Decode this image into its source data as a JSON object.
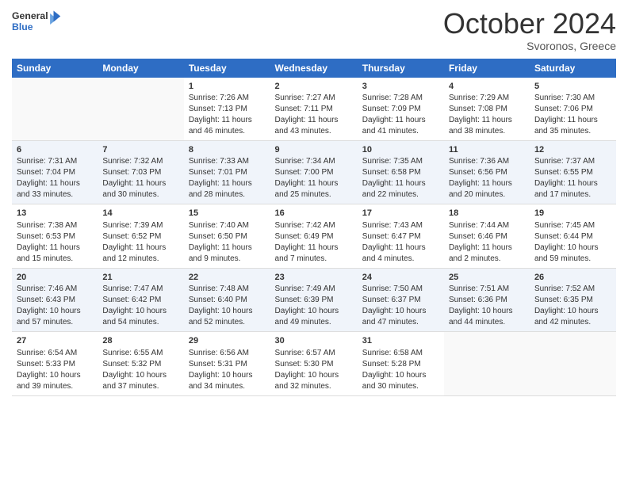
{
  "header": {
    "logo_line1": "General",
    "logo_line2": "Blue",
    "month": "October 2024",
    "location": "Svoronos, Greece"
  },
  "days_of_week": [
    "Sunday",
    "Monday",
    "Tuesday",
    "Wednesday",
    "Thursday",
    "Friday",
    "Saturday"
  ],
  "weeks": [
    [
      {
        "day": "",
        "info": ""
      },
      {
        "day": "",
        "info": ""
      },
      {
        "day": "1",
        "info": "Sunrise: 7:26 AM\nSunset: 7:13 PM\nDaylight: 11 hours and 46 minutes."
      },
      {
        "day": "2",
        "info": "Sunrise: 7:27 AM\nSunset: 7:11 PM\nDaylight: 11 hours and 43 minutes."
      },
      {
        "day": "3",
        "info": "Sunrise: 7:28 AM\nSunset: 7:09 PM\nDaylight: 11 hours and 41 minutes."
      },
      {
        "day": "4",
        "info": "Sunrise: 7:29 AM\nSunset: 7:08 PM\nDaylight: 11 hours and 38 minutes."
      },
      {
        "day": "5",
        "info": "Sunrise: 7:30 AM\nSunset: 7:06 PM\nDaylight: 11 hours and 35 minutes."
      }
    ],
    [
      {
        "day": "6",
        "info": "Sunrise: 7:31 AM\nSunset: 7:04 PM\nDaylight: 11 hours and 33 minutes."
      },
      {
        "day": "7",
        "info": "Sunrise: 7:32 AM\nSunset: 7:03 PM\nDaylight: 11 hours and 30 minutes."
      },
      {
        "day": "8",
        "info": "Sunrise: 7:33 AM\nSunset: 7:01 PM\nDaylight: 11 hours and 28 minutes."
      },
      {
        "day": "9",
        "info": "Sunrise: 7:34 AM\nSunset: 7:00 PM\nDaylight: 11 hours and 25 minutes."
      },
      {
        "day": "10",
        "info": "Sunrise: 7:35 AM\nSunset: 6:58 PM\nDaylight: 11 hours and 22 minutes."
      },
      {
        "day": "11",
        "info": "Sunrise: 7:36 AM\nSunset: 6:56 PM\nDaylight: 11 hours and 20 minutes."
      },
      {
        "day": "12",
        "info": "Sunrise: 7:37 AM\nSunset: 6:55 PM\nDaylight: 11 hours and 17 minutes."
      }
    ],
    [
      {
        "day": "13",
        "info": "Sunrise: 7:38 AM\nSunset: 6:53 PM\nDaylight: 11 hours and 15 minutes."
      },
      {
        "day": "14",
        "info": "Sunrise: 7:39 AM\nSunset: 6:52 PM\nDaylight: 11 hours and 12 minutes."
      },
      {
        "day": "15",
        "info": "Sunrise: 7:40 AM\nSunset: 6:50 PM\nDaylight: 11 hours and 9 minutes."
      },
      {
        "day": "16",
        "info": "Sunrise: 7:42 AM\nSunset: 6:49 PM\nDaylight: 11 hours and 7 minutes."
      },
      {
        "day": "17",
        "info": "Sunrise: 7:43 AM\nSunset: 6:47 PM\nDaylight: 11 hours and 4 minutes."
      },
      {
        "day": "18",
        "info": "Sunrise: 7:44 AM\nSunset: 6:46 PM\nDaylight: 11 hours and 2 minutes."
      },
      {
        "day": "19",
        "info": "Sunrise: 7:45 AM\nSunset: 6:44 PM\nDaylight: 10 hours and 59 minutes."
      }
    ],
    [
      {
        "day": "20",
        "info": "Sunrise: 7:46 AM\nSunset: 6:43 PM\nDaylight: 10 hours and 57 minutes."
      },
      {
        "day": "21",
        "info": "Sunrise: 7:47 AM\nSunset: 6:42 PM\nDaylight: 10 hours and 54 minutes."
      },
      {
        "day": "22",
        "info": "Sunrise: 7:48 AM\nSunset: 6:40 PM\nDaylight: 10 hours and 52 minutes."
      },
      {
        "day": "23",
        "info": "Sunrise: 7:49 AM\nSunset: 6:39 PM\nDaylight: 10 hours and 49 minutes."
      },
      {
        "day": "24",
        "info": "Sunrise: 7:50 AM\nSunset: 6:37 PM\nDaylight: 10 hours and 47 minutes."
      },
      {
        "day": "25",
        "info": "Sunrise: 7:51 AM\nSunset: 6:36 PM\nDaylight: 10 hours and 44 minutes."
      },
      {
        "day": "26",
        "info": "Sunrise: 7:52 AM\nSunset: 6:35 PM\nDaylight: 10 hours and 42 minutes."
      }
    ],
    [
      {
        "day": "27",
        "info": "Sunrise: 6:54 AM\nSunset: 5:33 PM\nDaylight: 10 hours and 39 minutes."
      },
      {
        "day": "28",
        "info": "Sunrise: 6:55 AM\nSunset: 5:32 PM\nDaylight: 10 hours and 37 minutes."
      },
      {
        "day": "29",
        "info": "Sunrise: 6:56 AM\nSunset: 5:31 PM\nDaylight: 10 hours and 34 minutes."
      },
      {
        "day": "30",
        "info": "Sunrise: 6:57 AM\nSunset: 5:30 PM\nDaylight: 10 hours and 32 minutes."
      },
      {
        "day": "31",
        "info": "Sunrise: 6:58 AM\nSunset: 5:28 PM\nDaylight: 10 hours and 30 minutes."
      },
      {
        "day": "",
        "info": ""
      },
      {
        "day": "",
        "info": ""
      }
    ]
  ]
}
